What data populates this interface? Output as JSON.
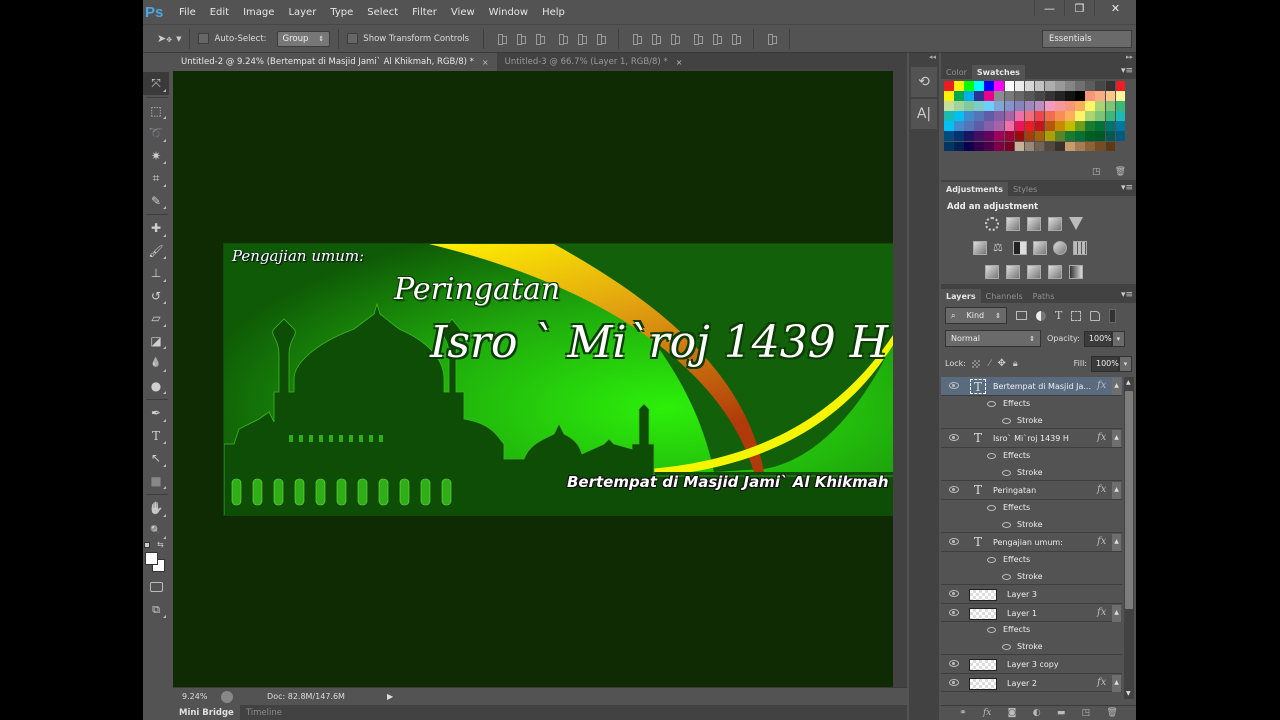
{
  "app": {
    "logo": "Ps",
    "menu": [
      "File",
      "Edit",
      "Image",
      "Layer",
      "Type",
      "Select",
      "Filter",
      "View",
      "Window",
      "Help"
    ],
    "window_controls": {
      "minimize": "—",
      "restore": "❐",
      "close": "✕"
    }
  },
  "options_bar": {
    "move_tool_icon": "move-tool-icon",
    "auto_select_label": "Auto-Select:",
    "auto_select_checked": false,
    "auto_select_mode": "Group",
    "show_transform_label": "Show Transform Controls",
    "show_transform_checked": false,
    "workspace": "Essentials"
  },
  "document_tabs": [
    {
      "title": "Untitled-2 @ 9.24% (Bertempat di Masjid Jami` Al Khikmah, RGB/8) *",
      "active": true,
      "close": "×"
    },
    {
      "title": "Untitled-3 @ 66.7% (Layer 1, RGB/8) *",
      "active": false,
      "close": "×"
    }
  ],
  "tools": [
    {
      "name": "move-tool",
      "glyph": "⤧",
      "active": true
    },
    {
      "name": "marquee-tool",
      "glyph": "⬚"
    },
    {
      "name": "lasso-tool",
      "glyph": "➰"
    },
    {
      "name": "quick-selection-tool",
      "glyph": "✷"
    },
    {
      "name": "crop-tool",
      "glyph": "⌗"
    },
    {
      "name": "eyedropper-tool",
      "glyph": "✎"
    },
    {
      "name": "healing-brush-tool",
      "glyph": "✚"
    },
    {
      "name": "brush-tool",
      "glyph": "🖌"
    },
    {
      "name": "clone-stamp-tool",
      "glyph": "⊥"
    },
    {
      "name": "history-brush-tool",
      "glyph": "↺"
    },
    {
      "name": "eraser-tool",
      "glyph": "▱"
    },
    {
      "name": "paint-bucket-tool",
      "glyph": "◪"
    },
    {
      "name": "blur-tool",
      "glyph": "💧"
    },
    {
      "name": "dodge-tool",
      "glyph": "●"
    },
    {
      "name": "pen-tool",
      "glyph": "✒"
    },
    {
      "name": "type-tool",
      "glyph": "T"
    },
    {
      "name": "path-selection-tool",
      "glyph": "↖"
    },
    {
      "name": "rectangle-tool",
      "glyph": "■"
    },
    {
      "name": "hand-tool",
      "glyph": "✋"
    },
    {
      "name": "zoom-tool",
      "glyph": "🔍"
    }
  ],
  "colors": {
    "foreground": "#ffffff",
    "background": "#ffffff"
  },
  "banner": {
    "pengajian": "Pengajian umum:",
    "peringatan": "Peringatan",
    "isro": "Isro ` Mi`roj 1439 H",
    "bertempat": "Bertempat di Masjid Jami` Al Khikmah"
  },
  "status_bar": {
    "zoom": "9.24%",
    "doc_size": "Doc: 82.8M/147.6M"
  },
  "bottom_tabs": [
    {
      "label": "Mini Bridge",
      "active": true
    },
    {
      "label": "Timeline",
      "active": false
    }
  ],
  "swatches_panel": {
    "tabs": [
      {
        "label": "Color",
        "active": false
      },
      {
        "label": "Swatches",
        "active": true
      }
    ],
    "colors": [
      "#ed1c24",
      "#fff200",
      "#00ff00",
      "#00ffff",
      "#0000ff",
      "#ff00ff",
      "#ffffff",
      "#ebebeb",
      "#d6d6d6",
      "#c2c2c2",
      "#adadad",
      "#999999",
      "#858585",
      "#707070",
      "#5c5c5c",
      "#474747",
      "#333333",
      "#ee1d24",
      "#fff200",
      "#00a651",
      "#00aeef",
      "#2e3192",
      "#ec008c",
      "#8c8c8c",
      "#7a7a7a",
      "#686868",
      "#575757",
      "#464646",
      "#353535",
      "#242424",
      "#131313",
      "#000000",
      "#f7977a",
      "#f9ad81",
      "#fdc68a",
      "#fff79a",
      "#c4df9b",
      "#a3d39c",
      "#82ca9d",
      "#7bcdc8",
      "#6ecff6",
      "#7ea7d8",
      "#8493ca",
      "#8882be",
      "#a187be",
      "#bc8dbf",
      "#f49ac2",
      "#f6989d",
      "#f7977a",
      "#fbaf5d",
      "#fff568",
      "#acd372",
      "#7cc576",
      "#3bb878",
      "#1abbb4",
      "#00bff3",
      "#438ccb",
      "#5574b9",
      "#605ca8",
      "#855fa8",
      "#a763a8",
      "#f06ea9",
      "#f26d7d",
      "#f1454e",
      "#f26c4f",
      "#f68e55",
      "#fbaf5c",
      "#fff467",
      "#acd372",
      "#7cc576",
      "#3bb878",
      "#1abbb4",
      "#00bff3",
      "#438ccb",
      "#5574b9",
      "#605ca8",
      "#855fa8",
      "#a763a8",
      "#f06ea9",
      "#ed145b",
      "#ed1c24",
      "#c4151c",
      "#b7570b",
      "#c88a00",
      "#c2bb00",
      "#6e9d1a",
      "#197b30",
      "#007236",
      "#00746b",
      "#0076a3",
      "#004a80",
      "#003471",
      "#1b1464",
      "#440e62",
      "#630460",
      "#9e005d",
      "#9e0039",
      "#9e0b0f",
      "#a0410d",
      "#a36209",
      "#aba000",
      "#598527",
      "#1a7b30",
      "#007236",
      "#005e20",
      "#005826",
      "#005952",
      "#005b7f",
      "#003663",
      "#002157",
      "#0d004c",
      "#32004b",
      "#4b0049",
      "#7b0046",
      "#7a0026",
      "#c7b299",
      "#998675",
      "#736357",
      "#534741",
      "#37302d",
      "#c69c6d",
      "#a67c52",
      "#8c6239",
      "#754c24",
      "#603913"
    ],
    "footer_icons": [
      "new-swatch-icon",
      "delete-swatch-icon"
    ]
  },
  "adjustments_panel": {
    "tabs": [
      {
        "label": "Adjustments",
        "active": true
      },
      {
        "label": "Styles",
        "active": false
      }
    ],
    "heading": "Add an adjustment",
    "rows": [
      [
        "brightness-contrast",
        "levels",
        "curves",
        "exposure",
        "vibrance"
      ],
      [
        "hue-saturation",
        "color-balance",
        "black-white",
        "photo-filter",
        "channel-mixer",
        "color-lookup"
      ],
      [
        "invert",
        "posterize",
        "threshold",
        "selective-color",
        "gradient-map"
      ]
    ]
  },
  "layers_panel": {
    "tabs": [
      {
        "label": "Layers",
        "active": true
      },
      {
        "label": "Channels",
        "active": false
      },
      {
        "label": "Paths",
        "active": false
      }
    ],
    "filter_kind": "Kind",
    "blend_mode": "Normal",
    "opacity_label": "Opacity:",
    "opacity": "100%",
    "lock_label": "Lock:",
    "fill_label": "Fill:",
    "fill": "100%",
    "effects_label": "Effects",
    "stroke_label": "Stroke",
    "layers": [
      {
        "name": "Bertempat di Masjid Ja...",
        "type": "text",
        "fx": true,
        "selected": true,
        "effects": [
          "Stroke"
        ]
      },
      {
        "name": "Isro` Mi`roj 1439 H",
        "type": "text",
        "fx": true,
        "effects": [
          "Stroke"
        ]
      },
      {
        "name": "Peringatan",
        "type": "text",
        "fx": true,
        "effects": [
          "Stroke"
        ]
      },
      {
        "name": "Pengajian umum:",
        "type": "text",
        "fx": true,
        "effects": [
          "Stroke"
        ]
      },
      {
        "name": "Layer 3",
        "type": "image",
        "fx": false
      },
      {
        "name": "Layer 1",
        "type": "image",
        "fx": true,
        "effects": [
          "Stroke"
        ]
      },
      {
        "name": "Layer 3 copy",
        "type": "image",
        "fx": false
      },
      {
        "name": "Layer 2",
        "type": "image",
        "fx": true
      }
    ],
    "footer_icons": [
      "link-layers-icon",
      "fx-icon",
      "mask-icon",
      "adjustment-layer-icon",
      "group-folder-icon",
      "new-layer-icon",
      "delete-layer-icon"
    ]
  }
}
